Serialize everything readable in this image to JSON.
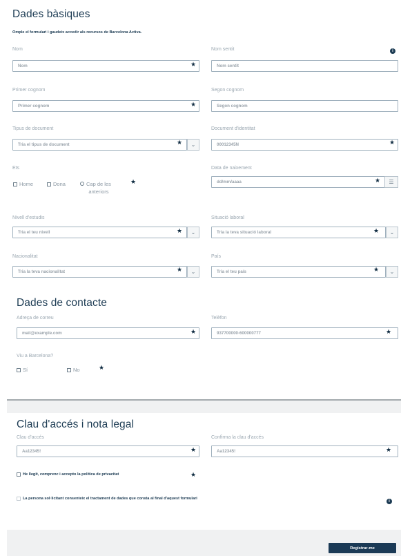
{
  "basic": {
    "title": "Dades bàsiques",
    "subtitle": "Omple el formulari i gaudeix accedir als recursos de Barcelona Activa.",
    "nom_label": "Nom",
    "nom_placeholder": "Nom",
    "nom_sentit_label": "Nom sentit",
    "nom_sentit_placeholder": "Nom sentit",
    "primer_cognom_label": "Primer cognom",
    "primer_cognom_placeholder": "Primer cognom",
    "segon_cognom_label": "Segon cognom",
    "segon_cognom_placeholder": "Segon cognom",
    "tipus_doc_label": "Tipus de document",
    "tipus_doc_value": "Tria el tipus de document",
    "doc_identitat_label": "Document d'identitat",
    "doc_identitat_placeholder": "00012345N",
    "ets_label": "Ets",
    "ets_options": [
      "Home",
      "Dona",
      "Cap de les anteriors"
    ],
    "ets_option_3_line1": "Cap de les",
    "ets_option_3_line2": "anteriors",
    "data_naixement_label": "Data de naixement",
    "data_naixement_placeholder": "dd/mm/aaaa",
    "nivell_estudis_label": "Nivell d'estudis",
    "nivell_estudis_value": "Tria el teu nivell",
    "situacio_laboral_label": "Situació laboral",
    "situacio_laboral_value": "Tria la teva situació laboral",
    "nacionalitat_label": "Nacionalitat",
    "nacionalitat_value": "Tria la teva nacionalitat",
    "pais_label": "País",
    "pais_value": "Tria el teu país"
  },
  "contact": {
    "title": "Dades de contacte",
    "email_label": "Adreça de correu",
    "email_placeholder": "mail@example.com",
    "telefon_label": "Telèfon",
    "telefon_placeholder": "937700000-600000777",
    "viu_label": "Viu a Barcelona?",
    "viu_options": [
      "Sí",
      "No"
    ]
  },
  "access": {
    "title": "Clau d'accés i nota legal",
    "clau_label": "Clau d'accés",
    "clau_placeholder": "Aa12345!",
    "confirma_label": "Confirma la clau d'accés",
    "confirma_placeholder": "Aa12345!",
    "privacy_text": "He llegit, comprenc i accepto la política de privacitat",
    "consent_text": "La persona sol·licitant consenteix el tractament de dades que consta al final d'aquest formulari"
  },
  "footer": {
    "register_label": "Registrar-me"
  },
  "icons": {
    "star": "★",
    "chevron": "⌄",
    "calendar": "☰",
    "info": "i",
    "checkbox": "☐",
    "radio": "○"
  },
  "colors": {
    "primary": "#1b3a56",
    "border": "#9fb0bd",
    "label": "#9aa7b1",
    "band": "#f0f1f2"
  }
}
